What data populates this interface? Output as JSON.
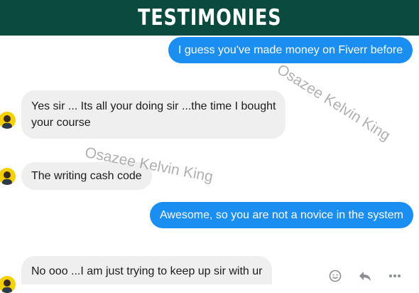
{
  "header": {
    "title": "TESTIMONIES"
  },
  "messages": [
    {
      "side": "outgoing",
      "text": "I guess you've made money on Fiverr before"
    },
    {
      "side": "incoming",
      "line1": "Yes sir ... Its all your doing sir ...the time I bought",
      "line2": "your course"
    },
    {
      "side": "incoming",
      "text": "The writing cash code"
    },
    {
      "side": "outgoing",
      "text": "Awesome, so you are not a novice in the system"
    },
    {
      "side": "incoming",
      "text": "No ooo ...I am just trying to keep up sir with ur"
    }
  ],
  "watermark": {
    "text": "Osazee Kelvin King"
  },
  "actions": [
    "emoji-icon",
    "reply-icon",
    "more-icon"
  ],
  "colors": {
    "banner": "#0b4a3e",
    "outgoing_bubble": "#1b8ef2",
    "incoming_bubble": "#efefef",
    "avatar": "#f5d000"
  }
}
